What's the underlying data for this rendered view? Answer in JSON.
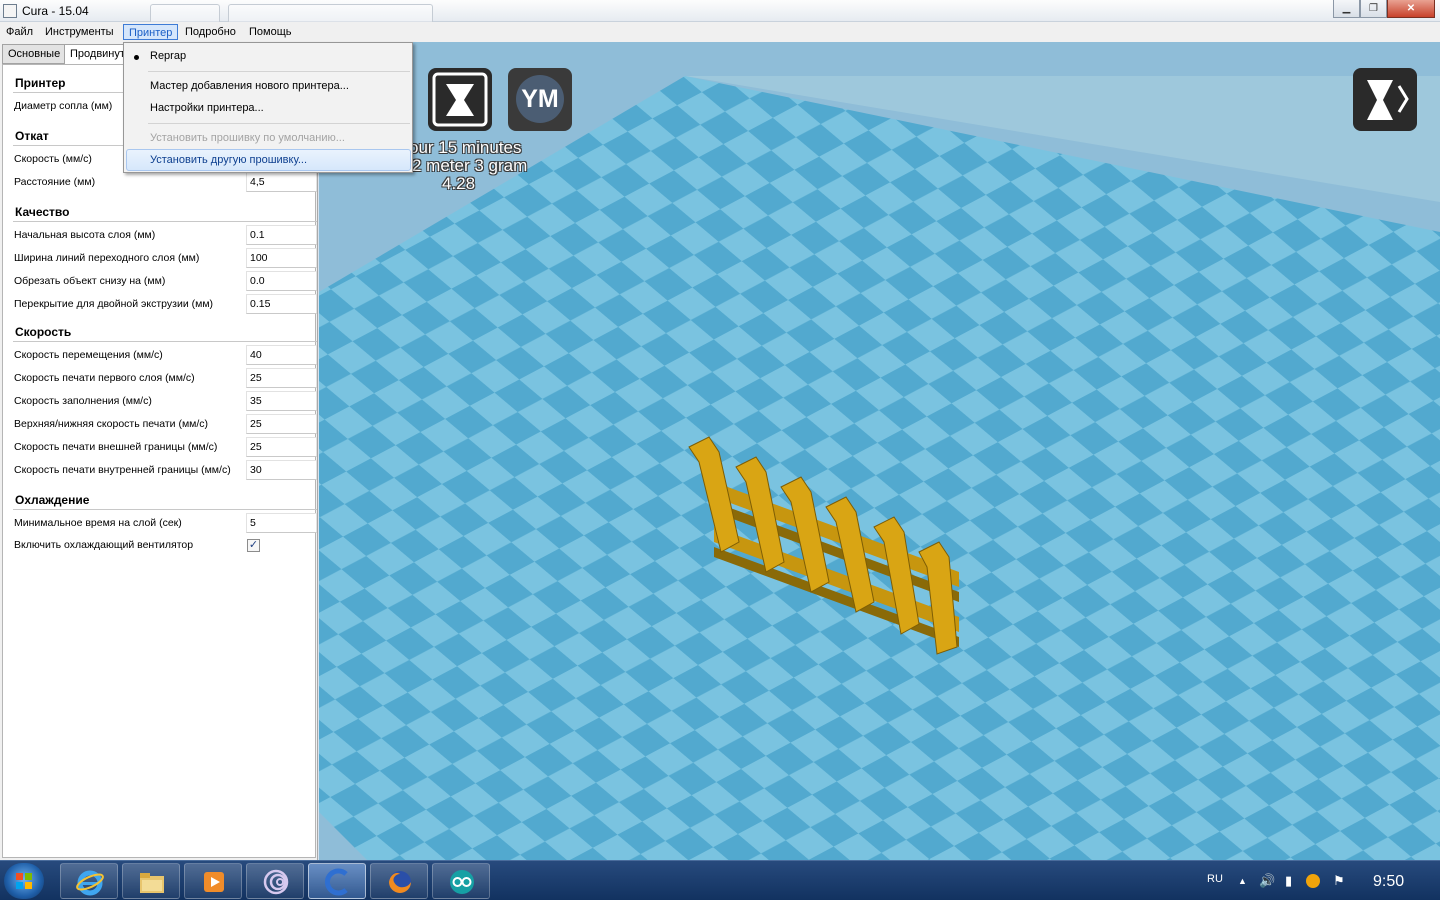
{
  "window": {
    "title": "Cura - 15.04",
    "controls": {
      "minimize": "▁",
      "maximize": "❐",
      "close": "✕"
    }
  },
  "menubar": {
    "items": [
      "Файл",
      "Инструменты",
      "Принтер",
      "Подробно",
      "Помощь"
    ],
    "active": "Принтер"
  },
  "printer_menu": {
    "items": [
      {
        "label": "Reprap",
        "checked": true,
        "enabled": true
      },
      {
        "label": "Мастер добавления нового принтера...",
        "enabled": true
      },
      {
        "label": "Настройки принтера...",
        "enabled": true
      },
      {
        "label": "Установить прошивку по умолчанию...",
        "enabled": false
      },
      {
        "label": "Установить другую прошивку...",
        "enabled": true,
        "highlighted": true
      }
    ]
  },
  "settings_tabs": [
    "Основные",
    "Продвинутые"
  ],
  "settings": {
    "printer": {
      "title": "Принтер",
      "rows": [
        {
          "label": "Диаметр сопла (мм)",
          "value": ""
        }
      ]
    },
    "retraction": {
      "title": "Откат",
      "rows": [
        {
          "label": "Скорость (мм/с)",
          "value": ""
        },
        {
          "label": "Расстояние (мм)",
          "value": "4,5"
        }
      ]
    },
    "quality": {
      "title": "Качество",
      "rows": [
        {
          "label": "Начальная высота слоя (мм)",
          "value": "0.1"
        },
        {
          "label": "Ширина линий переходного слоя (мм)",
          "value": "100"
        },
        {
          "label": "Обрезать объект снизу на (мм)",
          "value": "0.0"
        },
        {
          "label": "Перекрытие для двойной экструзии (мм)",
          "value": "0.15"
        }
      ]
    },
    "speed": {
      "title": "Скорость",
      "rows": [
        {
          "label": "Скорость перемещения (мм/с)",
          "value": "40"
        },
        {
          "label": "Скорость печати первого слоя (мм/с)",
          "value": "25"
        },
        {
          "label": "Скорость заполнения (мм/с)",
          "value": "35"
        },
        {
          "label": "Верхняя/нижняя скорость печати (мм/с)",
          "value": "25"
        },
        {
          "label": "Скорость печати внешней границы (мм/с)",
          "value": "25"
        },
        {
          "label": "Скорость печати внутренней границы (мм/с)",
          "value": "30"
        }
      ]
    },
    "cooling": {
      "title": "Охлаждение",
      "rows": [
        {
          "label": "Минимальное время на слой (сек)",
          "value": "5"
        }
      ],
      "fan": {
        "label": "Включить охлаждающий вентилятор",
        "checked": true,
        "mark": "✓"
      }
    }
  },
  "viewport": {
    "print_info": [
      "our 15 minutes",
      "2 meter 3 gram",
      "4.28"
    ],
    "ym_label": "YM",
    "platform_colors": {
      "dark": "#52a9cf",
      "light": "#7ac3e0",
      "sky": "#8fbdd8",
      "model": "#d9a514"
    }
  },
  "taskbar": {
    "tray": {
      "lang": "RU",
      "arrow": "▲",
      "volume": "🔊",
      "signal": "▮",
      "flag": "⚑"
    },
    "clock": "9:50"
  }
}
